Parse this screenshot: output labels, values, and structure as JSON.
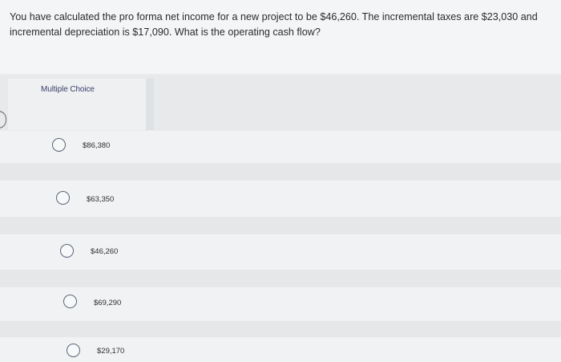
{
  "question": {
    "text": "You have calculated the pro forma net income for a new project to be $46,260. The incremental taxes are $23,030 and incremental depreciation is $17,090. What is the operating cash flow?"
  },
  "multiple_choice": {
    "label": "Multiple Choice",
    "options": [
      {
        "label": "$86,380"
      },
      {
        "label": "$63,350"
      },
      {
        "label": "$46,260"
      },
      {
        "label": "$69,290"
      },
      {
        "label": "$29,170"
      }
    ]
  }
}
